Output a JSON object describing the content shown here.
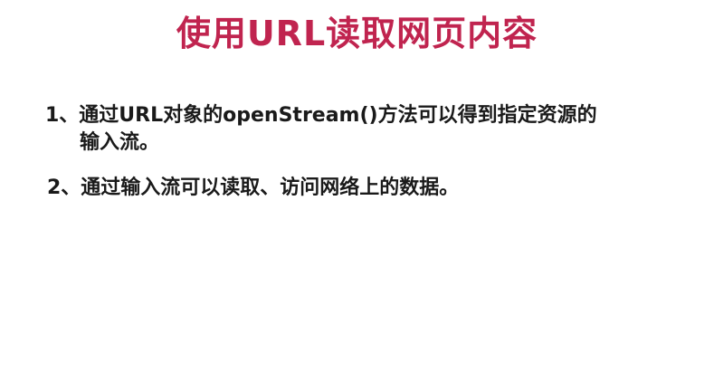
{
  "slide": {
    "title": "使用URL读取网页内容",
    "points": [
      {
        "line1": "1、通过URL对象的openStream()方法可以得到指定资源的",
        "line2": "输入流。"
      },
      {
        "line1": "2、通过输入流可以读取、访问网络上的数据。"
      }
    ]
  },
  "colors": {
    "title": "#c0244f",
    "body_text": "#1a1a1a",
    "background": "#ffffff"
  }
}
